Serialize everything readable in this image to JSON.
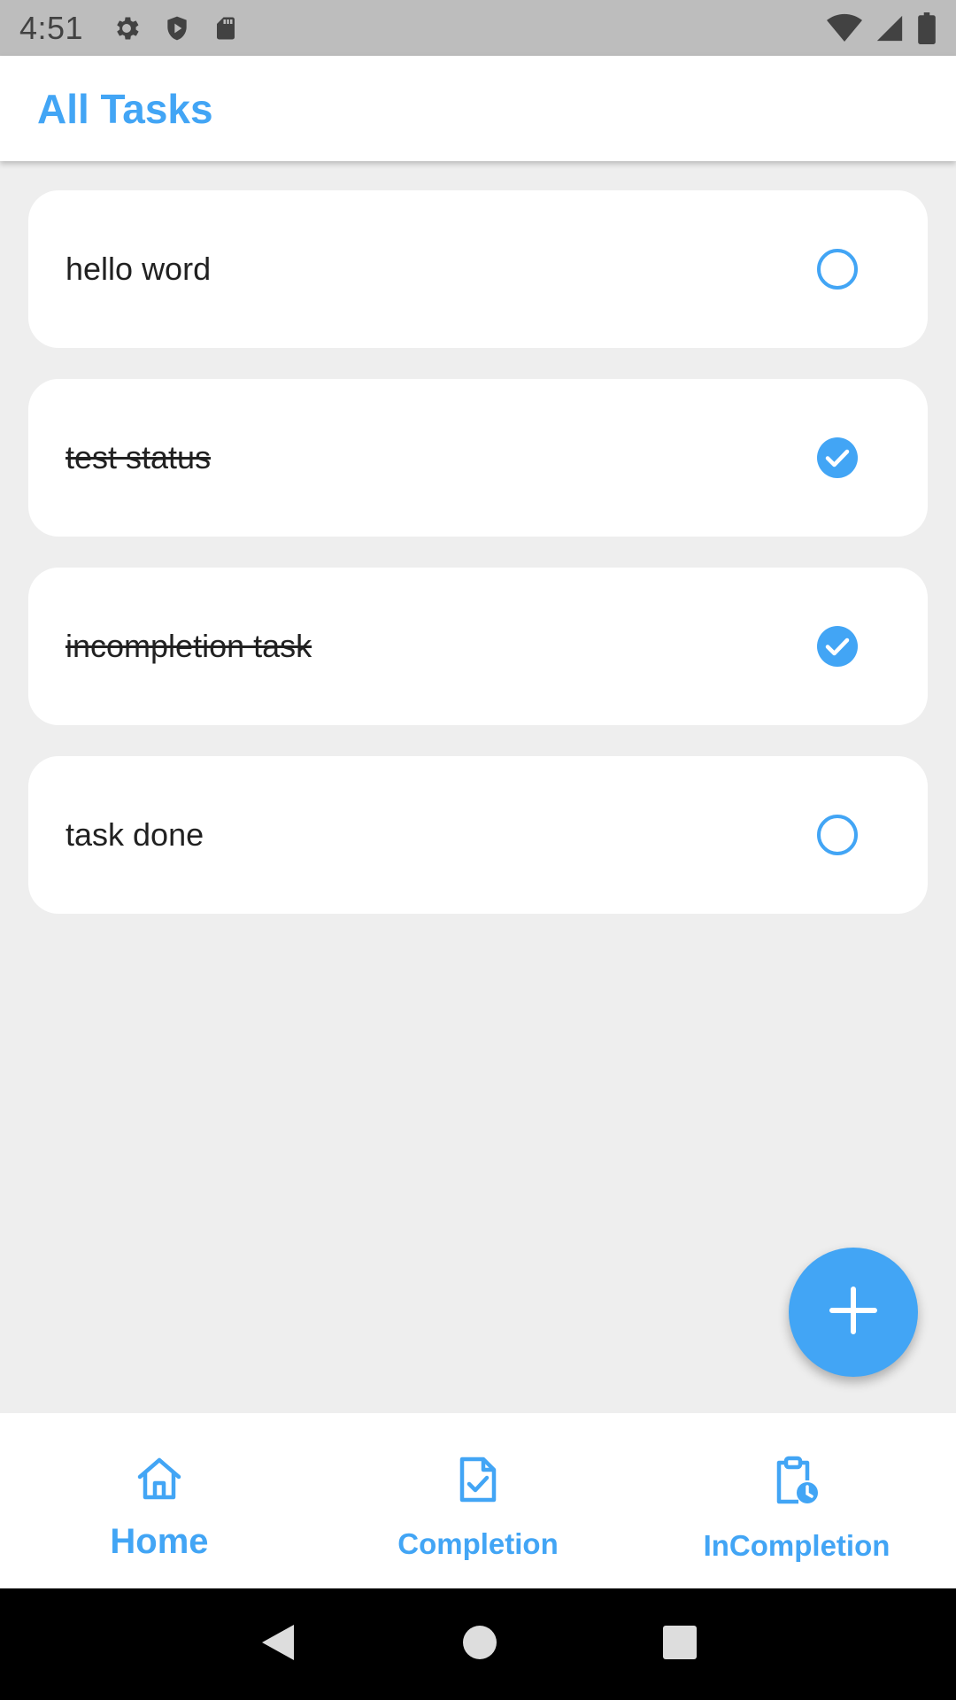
{
  "status_bar": {
    "time": "4:51",
    "icons_left": [
      "gear-icon",
      "shield-icon",
      "sd-card-icon"
    ],
    "icons_right": [
      "wifi-icon",
      "signal-icon",
      "battery-icon"
    ]
  },
  "app_bar": {
    "title": "All Tasks"
  },
  "tasks": [
    {
      "title": "hello word",
      "completed": false
    },
    {
      "title": "test status",
      "completed": true
    },
    {
      "title": "incompletion task",
      "completed": true
    },
    {
      "title": "task done",
      "completed": false
    }
  ],
  "fab": {
    "icon": "plus-icon"
  },
  "bottom_nav": {
    "items": [
      {
        "label": "Home",
        "icon": "home-icon",
        "active": true
      },
      {
        "label": "Completion",
        "icon": "document-check-icon",
        "active": false
      },
      {
        "label": "InCompletion",
        "icon": "clipboard-clock-icon",
        "active": false
      }
    ]
  },
  "system_nav": {
    "icons": [
      "back-icon",
      "home-circle-icon",
      "recents-icon"
    ]
  },
  "colors": {
    "accent": "#42a5f5",
    "status_bar": "#bdbdbd",
    "background": "#eeeeee"
  }
}
